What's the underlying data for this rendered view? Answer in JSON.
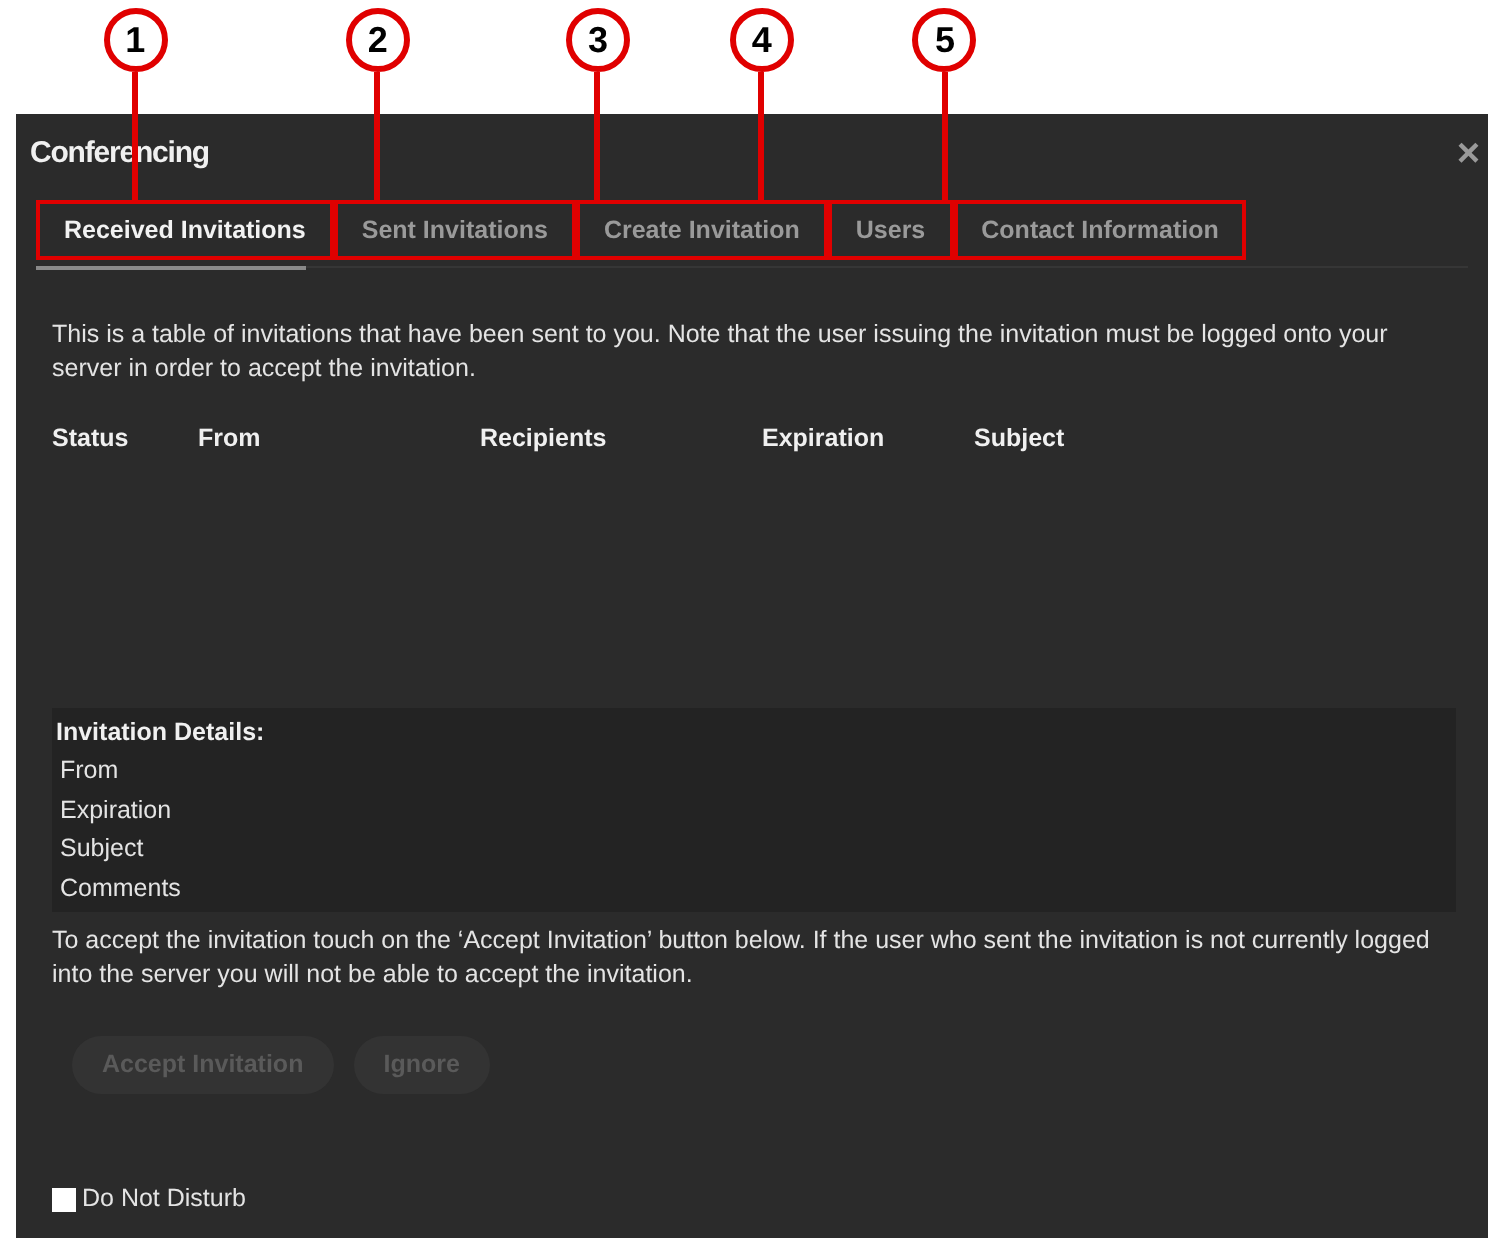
{
  "window": {
    "title": "Conferencing",
    "close": "×"
  },
  "tabs": [
    {
      "label": "Received Invitations",
      "selected": true
    },
    {
      "label": "Sent Invitations",
      "selected": false
    },
    {
      "label": "Create Invitation",
      "selected": false
    },
    {
      "label": "Users",
      "selected": false
    },
    {
      "label": "Contact Information",
      "selected": false
    }
  ],
  "callouts": [
    "1",
    "2",
    "3",
    "4",
    "5"
  ],
  "description": "This is a table of invitations that have been sent to you. Note that the user issuing the invitation must be logged onto your server in order to accept the invitation.",
  "table": {
    "columns": [
      "Status",
      "From",
      "Recipients",
      "Expiration",
      "Subject"
    ]
  },
  "details": {
    "heading": "Invitation Details:",
    "fields": [
      "From",
      "Expiration",
      "Subject",
      "Comments"
    ]
  },
  "instructions": "To accept the invitation touch on the ‘Accept Invitation’ button below. If the user who sent the invitation is not currently logged into the server you will not be able to accept the invitation.",
  "buttons": [
    {
      "label": "Accept Invitation",
      "disabled": true
    },
    {
      "label": "Ignore",
      "disabled": true
    }
  ],
  "do_not_disturb": {
    "label": "Do Not Disturb",
    "checked": false
  }
}
